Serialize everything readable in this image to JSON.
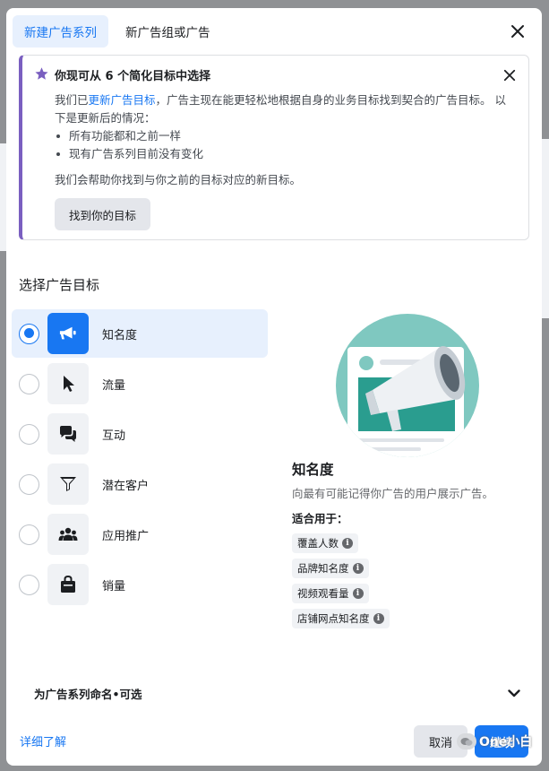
{
  "tabs": [
    {
      "label": "新建广告系列",
      "active": true
    },
    {
      "label": "新广告组或广告",
      "active": false
    }
  ],
  "notice": {
    "title": "你现可从 6 个简化目标中选择",
    "body_prefix": "我们已",
    "body_link": "更新广告目标",
    "body_suffix": "，广告主现在能更轻松地根据自身的业务目标找到契合的广告目标。 以下是更新后的情况：",
    "bullets": [
      "所有功能都和之前一样",
      "现有广告系列目前没有变化"
    ],
    "help_text": "我们会帮助你找到与你之前的目标对应的新目标。",
    "button_label": "找到你的目标",
    "accent_color": "#7a5fc0"
  },
  "objectives": {
    "title": "选择广告目标",
    "items": [
      {
        "label": "知名度",
        "icon": "megaphone-icon",
        "selected": true
      },
      {
        "label": "流量",
        "icon": "cursor-icon",
        "selected": false
      },
      {
        "label": "互动",
        "icon": "chat-bubbles-icon",
        "selected": false
      },
      {
        "label": "潜在客户",
        "icon": "funnel-icon",
        "selected": false
      },
      {
        "label": "应用推广",
        "icon": "people-icon",
        "selected": false
      },
      {
        "label": "销量",
        "icon": "shopping-bag-icon",
        "selected": false
      }
    ]
  },
  "detail": {
    "title": "知名度",
    "description": "向最有可能记得你广告的用户展示广告。",
    "suitable_label": "适合用于：",
    "tags": [
      "覆盖人数",
      "品牌知名度",
      "视频观看量",
      "店铺网点知名度"
    ]
  },
  "footer": {
    "name_campaign": "为广告系列命名•可选",
    "learn_more": "详细了解",
    "cancel": "取消",
    "continue": "继续"
  },
  "watermark": {
    "text": "One小白"
  },
  "colors": {
    "primary": "#1877f2",
    "selected_bg": "#e7f0fd"
  }
}
